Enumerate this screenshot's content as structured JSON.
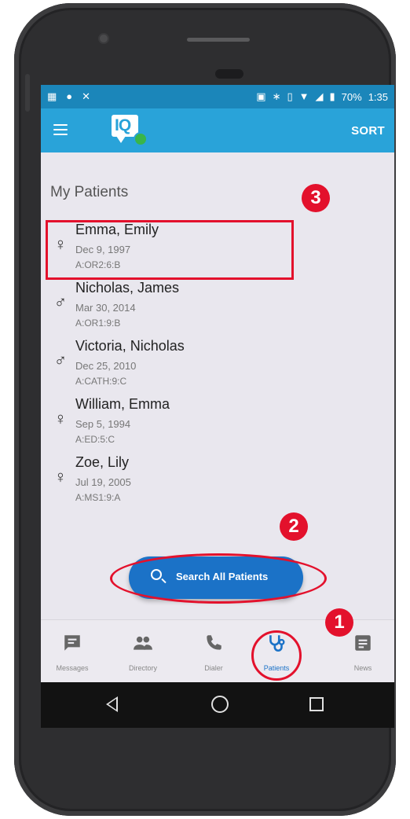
{
  "status_bar": {
    "left_icons": [
      "sim-icon",
      "android-icon",
      "missed-call-icon"
    ],
    "battery": "70%",
    "time": "1:35"
  },
  "app_bar": {
    "logo_text": "IQ",
    "sort_label": "SORT"
  },
  "page_title": "My Patients",
  "patients": [
    {
      "gender": "female",
      "symbol": "♀",
      "name": "Emma, Emily",
      "dob": "Dec 9, 1997",
      "location": "A:OR2:6:B"
    },
    {
      "gender": "male",
      "symbol": "♂",
      "name": "Nicholas, James",
      "dob": "Mar 30, 2014",
      "location": "A:OR1:9:B"
    },
    {
      "gender": "male",
      "symbol": "♂",
      "name": "Victoria, Nicholas",
      "dob": "Dec 25, 2010",
      "location": "A:CATH:9:C"
    },
    {
      "gender": "female",
      "symbol": "♀",
      "name": "William, Emma",
      "dob": "Sep 5, 1994",
      "location": "A:ED:5:C"
    },
    {
      "gender": "female",
      "symbol": "♀",
      "name": "Zoe, Lily",
      "dob": "Jul 19, 2005",
      "location": "A:MS1:9:A"
    }
  ],
  "search_button": {
    "label": "Search All Patients"
  },
  "bottom_nav": [
    {
      "label": "Messages",
      "icon": "message-icon"
    },
    {
      "label": "Directory",
      "icon": "people-icon"
    },
    {
      "label": "Dialer",
      "icon": "phone-icon"
    },
    {
      "label": "Patients",
      "icon": "stethoscope-icon",
      "active": true
    },
    {
      "label": "News",
      "icon": "news-icon"
    }
  ],
  "annotations": {
    "badge_1": "1",
    "badge_2": "2",
    "badge_3": "3"
  },
  "colors": {
    "app_bar": "#29a3d9",
    "status_bar": "#1b86ba",
    "accent": "#1b72c7",
    "annotation_red": "#e3112c"
  }
}
